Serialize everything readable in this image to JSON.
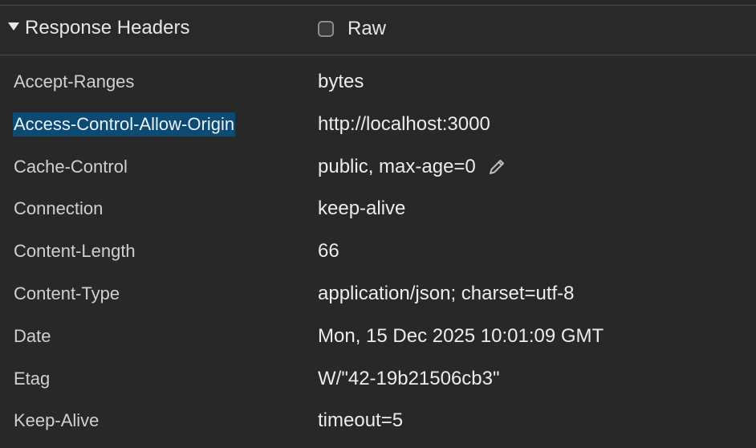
{
  "section": {
    "title": "Response Headers",
    "expanded": true,
    "raw_label": "Raw",
    "raw_checked": false
  },
  "headers": [
    {
      "name": "Accept-Ranges",
      "value": "bytes"
    },
    {
      "name": "Access-Control-Allow-Origin",
      "value": "http://localhost:3000",
      "selected": true
    },
    {
      "name": "Cache-Control",
      "value": "public, max-age=0",
      "editable": true
    },
    {
      "name": "Connection",
      "value": "keep-alive"
    },
    {
      "name": "Content-Length",
      "value": "66"
    },
    {
      "name": "Content-Type",
      "value": "application/json; charset=utf-8"
    },
    {
      "name": "Date",
      "value": "Mon, 15 Dec 2025 10:01:09 GMT"
    },
    {
      "name": "Etag",
      "value": "W/\"42-19b21506cb3\""
    },
    {
      "name": "Keep-Alive",
      "value": "timeout=5"
    }
  ],
  "icons": {
    "disclosure": "triangle-down-icon",
    "edit": "pencil-icon"
  },
  "colors": {
    "background": "#282828",
    "selection": "#0c4a72",
    "text": "#ececec",
    "divider": "#4a4a4a"
  }
}
